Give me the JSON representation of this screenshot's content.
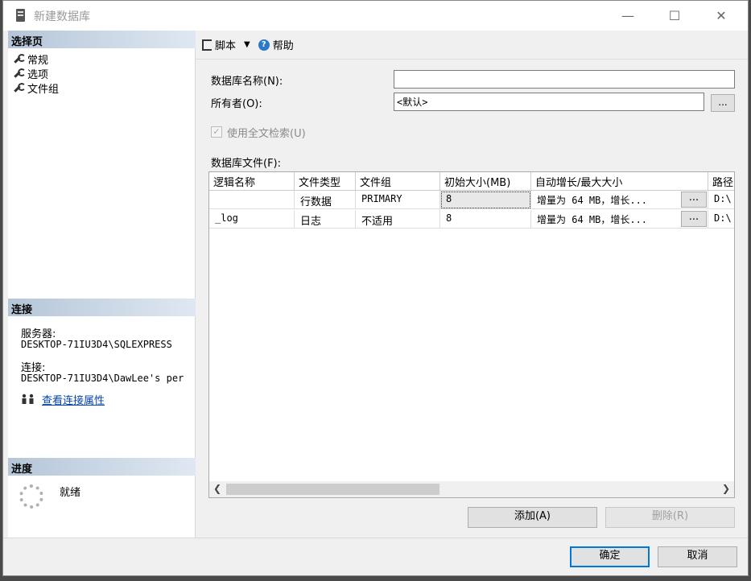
{
  "window": {
    "title": "新建数据库",
    "controls": {
      "minimize": "—",
      "maximize": "☐",
      "close": "✕"
    }
  },
  "left": {
    "select_page_header": "选择页",
    "nav_items": [
      "常规",
      "选项",
      "文件组"
    ],
    "connection_header": "连接",
    "server_label": "服务器:",
    "server_value": "DESKTOP-71IU3D4\\SQLEXPRESS",
    "connection_label": "连接:",
    "connection_value": "DESKTOP-71IU3D4\\DawLee's per",
    "view_props_link": "查看连接属性",
    "progress_header": "进度",
    "progress_status": "就绪"
  },
  "toolbar": {
    "script_label": "脚本",
    "script_dropdown": "▼",
    "help_label": "帮助"
  },
  "form": {
    "db_name_label": "数据库名称(N):",
    "db_name_value": "",
    "owner_label": "所有者(O):",
    "owner_value": "<默认>",
    "owner_browse": "...",
    "fulltext_label": "使用全文检索(U)",
    "fulltext_checked": true,
    "files_label": "数据库文件(F):"
  },
  "grid": {
    "columns": [
      "逻辑名称",
      "文件类型",
      "文件组",
      "初始大小(MB)",
      "自动增长/最大大小",
      "路径"
    ],
    "rows": [
      {
        "logical": "",
        "type": "行数据",
        "filegroup": "PRIMARY",
        "size": "8",
        "growth": "增量为 64 MB，增长...",
        "browse": "...",
        "path": "D:\\"
      },
      {
        "logical": "_log",
        "type": "日志",
        "filegroup": "不适用",
        "size": "8",
        "growth": "增量为 64 MB，增长...",
        "browse": "...",
        "path": "D:\\"
      }
    ]
  },
  "buttons": {
    "add": "添加(A)",
    "remove": "删除(R)",
    "ok": "确定",
    "cancel": "取消"
  }
}
